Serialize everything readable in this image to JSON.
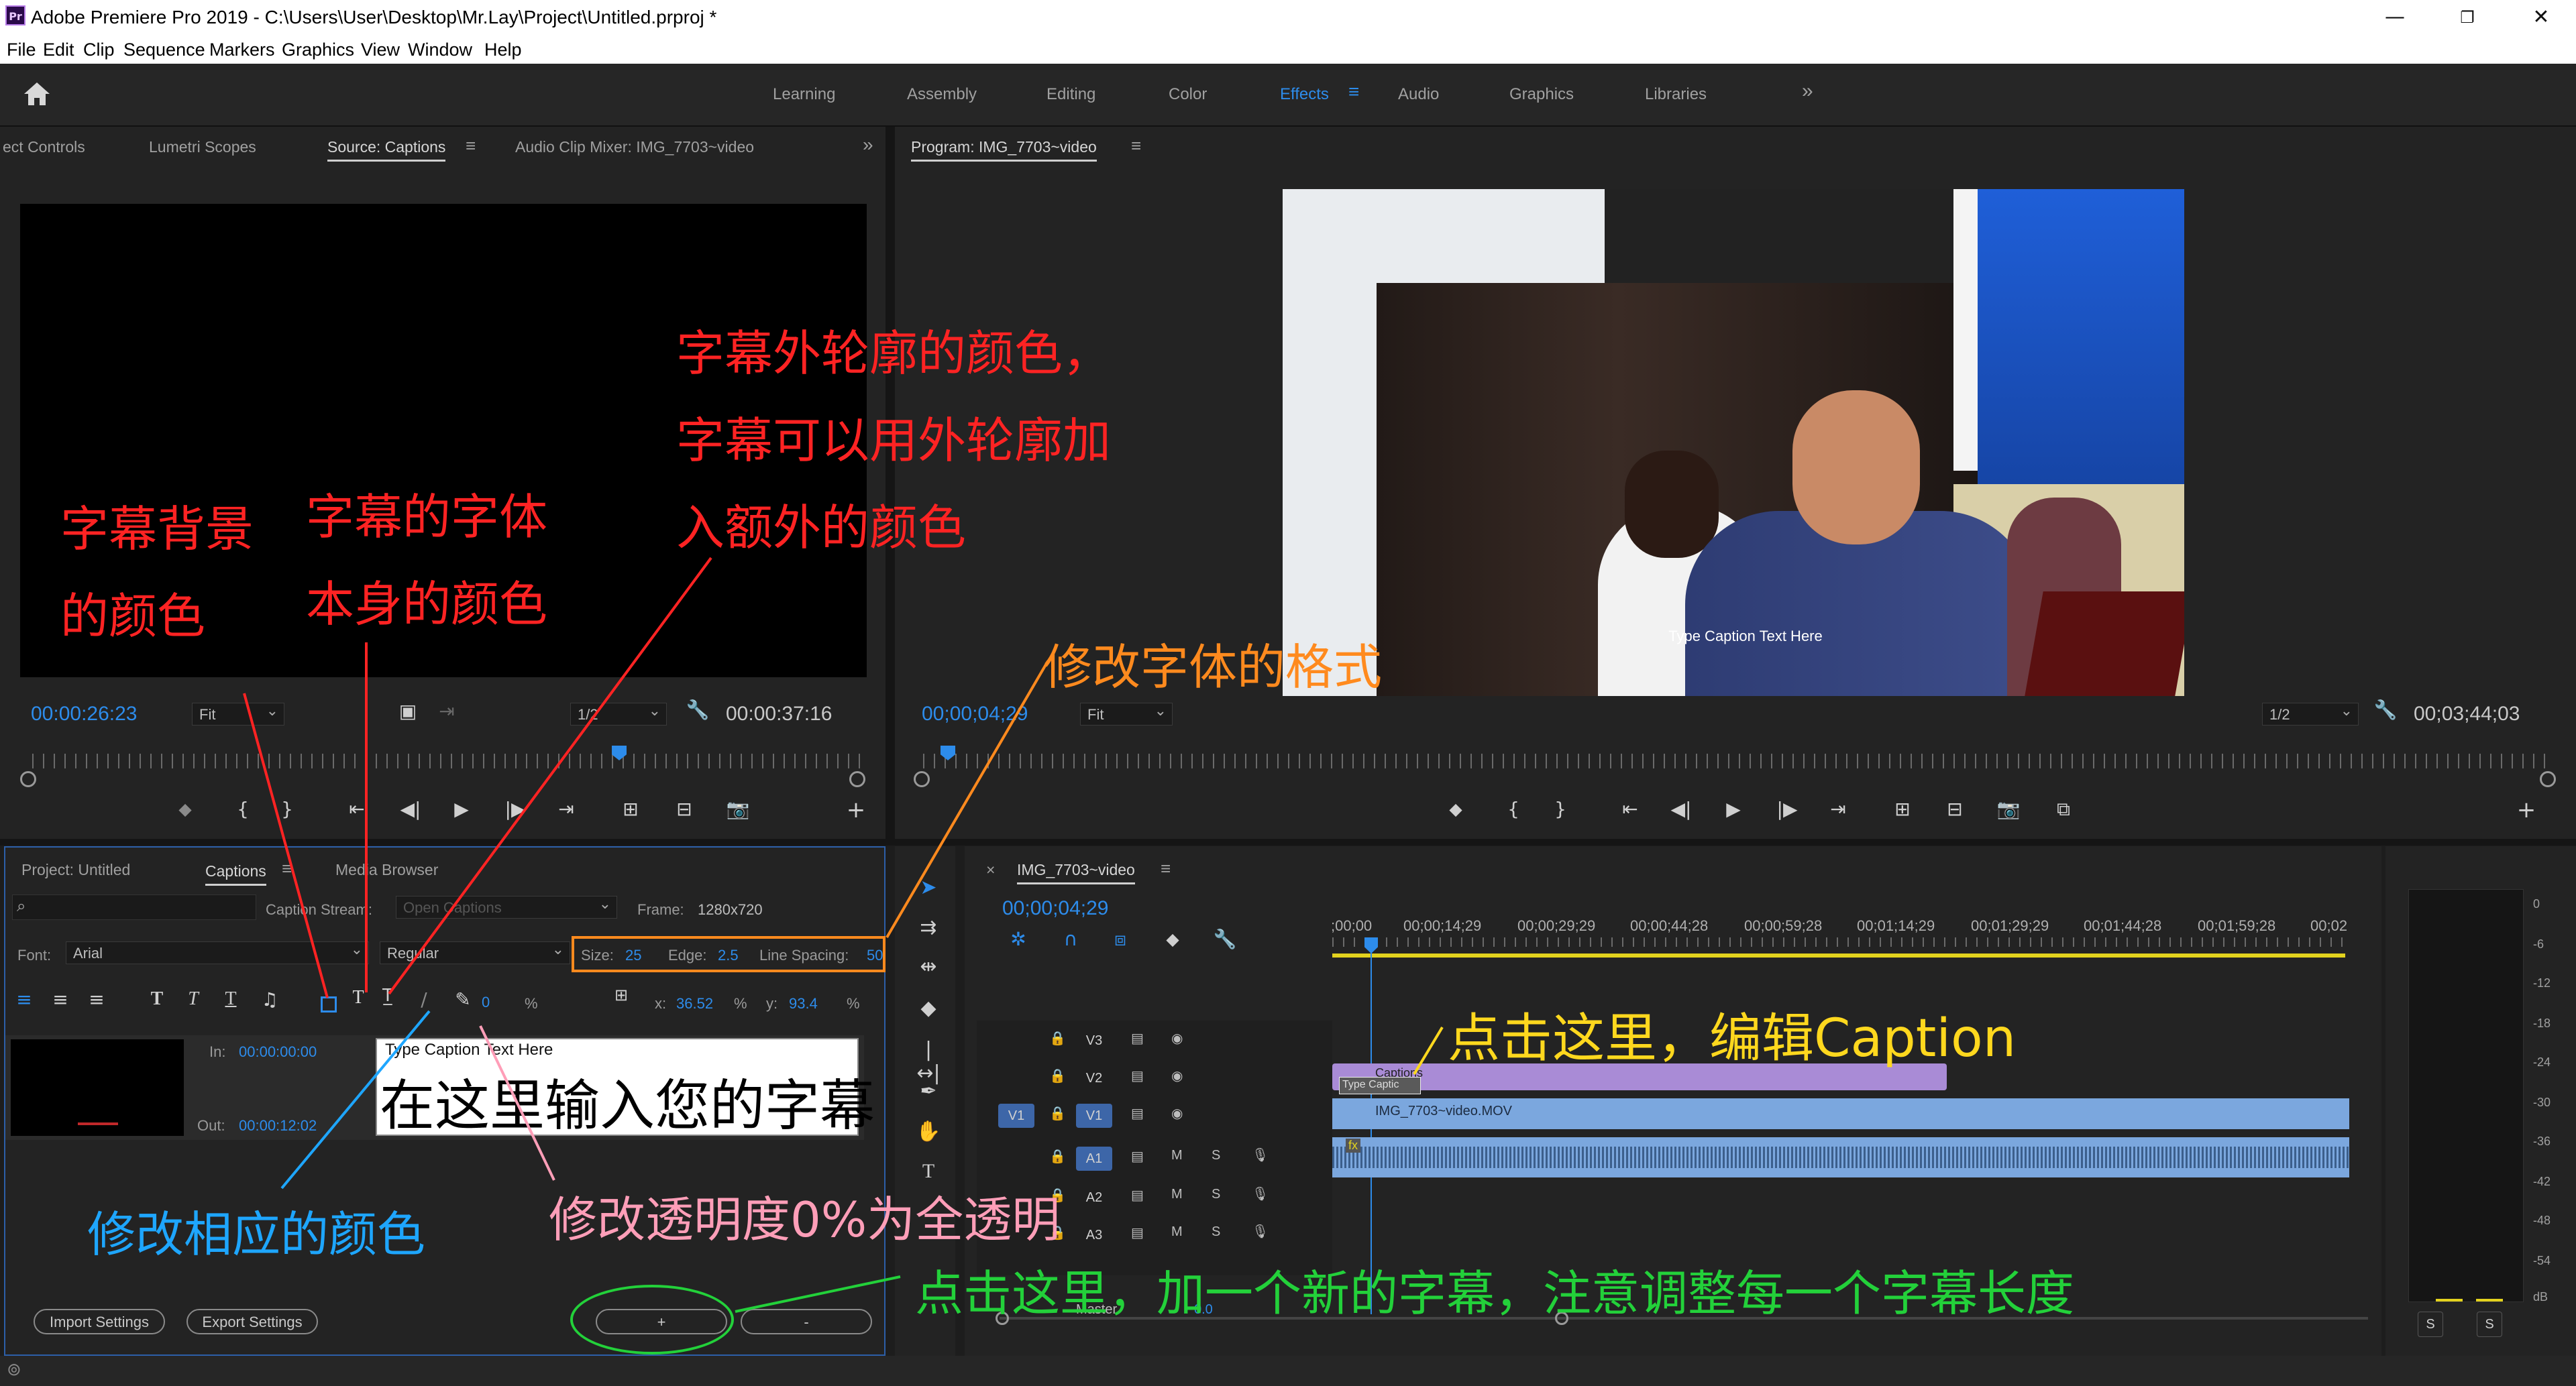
{
  "window": {
    "app_icon": "Pr",
    "title": "Adobe Premiere Pro 2019 - C:\\Users\\User\\Desktop\\Mr.Lay\\Project\\Untitled.prproj *",
    "minimize": "—",
    "restore": "❐",
    "close": "✕"
  },
  "menu": [
    "File",
    "Edit",
    "Clip",
    "Sequence",
    "Markers",
    "Graphics",
    "View",
    "Window",
    "Help"
  ],
  "workspaces": {
    "items": [
      "Learning",
      "Assembly",
      "Editing",
      "Color",
      "Effects",
      "Audio",
      "Graphics",
      "Libraries"
    ],
    "active": "Effects",
    "more": "»"
  },
  "source_panel": {
    "tabs": [
      "ect Controls",
      "Lumetri Scopes",
      "Source: Captions",
      "Audio Clip Mixer: IMG_7703~video"
    ],
    "active_tab": "Source: Captions",
    "timecode_in": "00:00:26:23",
    "fit": "Fit",
    "resolution": "1/2",
    "timecode_out": "00:00:37:16"
  },
  "program_panel": {
    "title": "Program: IMG_7703~video",
    "timecode_in": "00;00;04;29",
    "fit": "Fit",
    "resolution": "1/2",
    "timecode_out": "00;03;44;03",
    "caption_overlay": "Type Caption Text Here"
  },
  "captions_panel": {
    "tabs": [
      "Project: Untitled",
      "Captions",
      "Media Browser"
    ],
    "active_tab": "Captions",
    "caption_stream_label": "Caption Stream:",
    "caption_stream_value": "Open Captions",
    "frame_label": "Frame:",
    "frame_value": "1280x720",
    "font_label": "Font:",
    "font_value": "Arial",
    "style_value": "Regular",
    "size_label": "Size:",
    "size_value": "25",
    "edge_label": "Edge:",
    "edge_value": "2.5",
    "line_spacing_label": "Line Spacing:",
    "line_spacing_value": "50",
    "opacity_value": "0",
    "percent": "%",
    "x_label": "x:",
    "x_value": "36.52",
    "y_label": "y:",
    "y_value": "93.4",
    "in_label": "In:",
    "in_value": "00:00:00:00",
    "out_label": "Out:",
    "out_value": "00:00:12:02",
    "caption_text": "Type Caption Text Here",
    "import_settings": "Import Settings",
    "export_settings": "Export Settings",
    "add_button": "+",
    "remove_button": "-"
  },
  "timeline": {
    "sequence": "IMG_7703~video",
    "timecode": "00;00;04;29",
    "ruler_labels": [
      ";00;00",
      "00;00;14;29",
      "00;00;29;29",
      "00;00;44;28",
      "00;00;59;28",
      "00;01;14;29",
      "00;01;29;29",
      "00;01;44;28",
      "00;01;59;28",
      "00;02"
    ],
    "tracks": {
      "v3": "V3",
      "v2": "V2",
      "v1": "V1",
      "v1_source": "V1",
      "a1": "A1",
      "a2": "A2",
      "a3": "A3",
      "master": "Master",
      "master_value": "0.0",
      "mute": "M",
      "solo": "S"
    },
    "clips": {
      "captions_clip": "Captions",
      "captions_sub": "Type Captic",
      "video_clip": "IMG_7703~video.MOV",
      "fx_badge": "fx"
    }
  },
  "audio_meter": {
    "db_scale": [
      "0",
      "-6",
      "-12",
      "-18",
      "-24",
      "-30",
      "-36",
      "-42",
      "-48",
      "-54",
      "dB"
    ],
    "solo_left": "S",
    "solo_right": "S"
  },
  "annotations": {
    "bg_color": [
      "字幕背景",
      "的颜色"
    ],
    "font_color": [
      "字幕的字体",
      "本身的颜色"
    ],
    "outline_color": [
      "字幕外轮廓的颜色，",
      "字幕可以用外轮廓加",
      "入额外的颜色"
    ],
    "format": "修改字体的格式",
    "edit_caption": "点击这里，编辑Caption",
    "type_here": "在这里输入您的字幕",
    "change_color": "修改相应的颜色",
    "opacity": "修改透明度0%为全透明",
    "add_new": "点击这里，加一个新的字幕，注意调整每一个字幕长度"
  },
  "colors": {
    "accent_blue": "#2d8ceb",
    "ann_red": "#ff2323",
    "ann_orange": "#ff8a1e",
    "ann_yellow": "#ffd81e",
    "ann_blue": "#1ea6ff",
    "ann_pink": "#ff9eb8",
    "ann_green": "#23d13a",
    "caption_clip": "#a98bd6",
    "video_clip": "#7ba7de"
  }
}
